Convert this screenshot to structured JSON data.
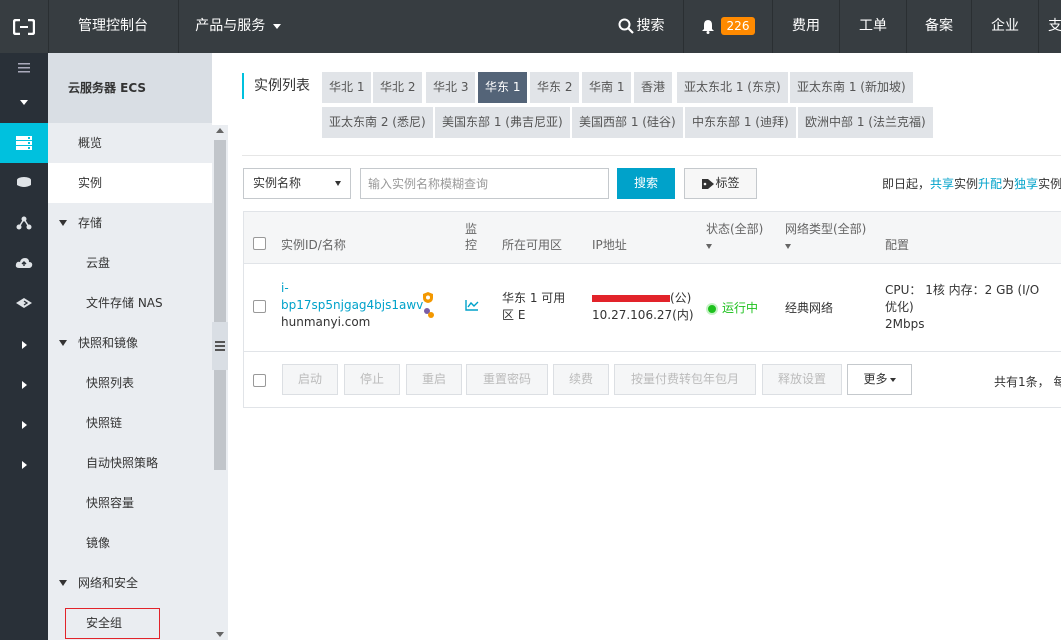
{
  "topbar": {
    "console_label": "管理控制台",
    "products_label": "产品与服务",
    "search_label": "搜索",
    "notif_count": "226",
    "billing_label": "费用",
    "ticket_label": "工单",
    "icp_label": "备案",
    "enterprise_label": "企业",
    "more_label": "支"
  },
  "sidebar": {
    "title": "云服务器 ECS",
    "items": [
      {
        "label": "概览"
      },
      {
        "label": "实例"
      },
      {
        "label": "存储"
      },
      {
        "label": "云盘"
      },
      {
        "label": "文件存储 NAS"
      },
      {
        "label": "快照和镜像"
      },
      {
        "label": "快照列表"
      },
      {
        "label": "快照链"
      },
      {
        "label": "自动快照策略"
      },
      {
        "label": "快照容量"
      },
      {
        "label": "镜像"
      },
      {
        "label": "网络和安全"
      },
      {
        "label": "安全组"
      }
    ]
  },
  "regions": {
    "label": "实例列表",
    "tabs": [
      "华北 1",
      "华北 2",
      "华北 3",
      "华东 1",
      "华东 2",
      "华南 1",
      "香港",
      "亚太东北 1 (东京)",
      "亚太东南 1 (新加坡)",
      "亚太东南 2 (悉尼)",
      "美国东部 1 (弗吉尼亚)",
      "美国西部 1 (硅谷)",
      "中东东部 1 (迪拜)",
      "欧洲中部 1 (法兰克福)"
    ],
    "active": "华东 1"
  },
  "toolbar": {
    "filter_select": "实例名称",
    "search_placeholder": "输入实例名称模糊查询",
    "search_button": "搜索",
    "tag_button": "标签",
    "notice_prefix": "即日起，",
    "notice_link1": "共享",
    "notice_mid1": "实例",
    "notice_link2": "升配",
    "notice_mid2": "为",
    "notice_link3": "独享",
    "notice_suffix": "实例"
  },
  "table": {
    "headers": {
      "id_name": "实例ID/名称",
      "monitor": "监控",
      "zone": "所在可用区",
      "ip": "IP地址",
      "status": "状态(全部)",
      "network": "网络类型(全部)",
      "config": "配置"
    },
    "rows": [
      {
        "id_prefix": "i-",
        "id": "bp17sp5njgag4bjs1awv",
        "name": "hunmanyi.com",
        "zone": "华东 1 可用区 E",
        "ip_public_suffix": "(公)",
        "ip_private": "10.27.106.27(内)",
        "status": "运行中",
        "network": "经典网络",
        "config_line1": "CPU： 1核    内存：2 GB (I/O",
        "config_line2": "优化)",
        "config_line3": "2Mbps"
      }
    ],
    "footer_buttons": [
      "启动",
      "停止",
      "重启",
      "重置密码",
      "续费",
      "按量付费转包年包月",
      "释放设置",
      "更多"
    ],
    "total": "共有1条， 每"
  }
}
